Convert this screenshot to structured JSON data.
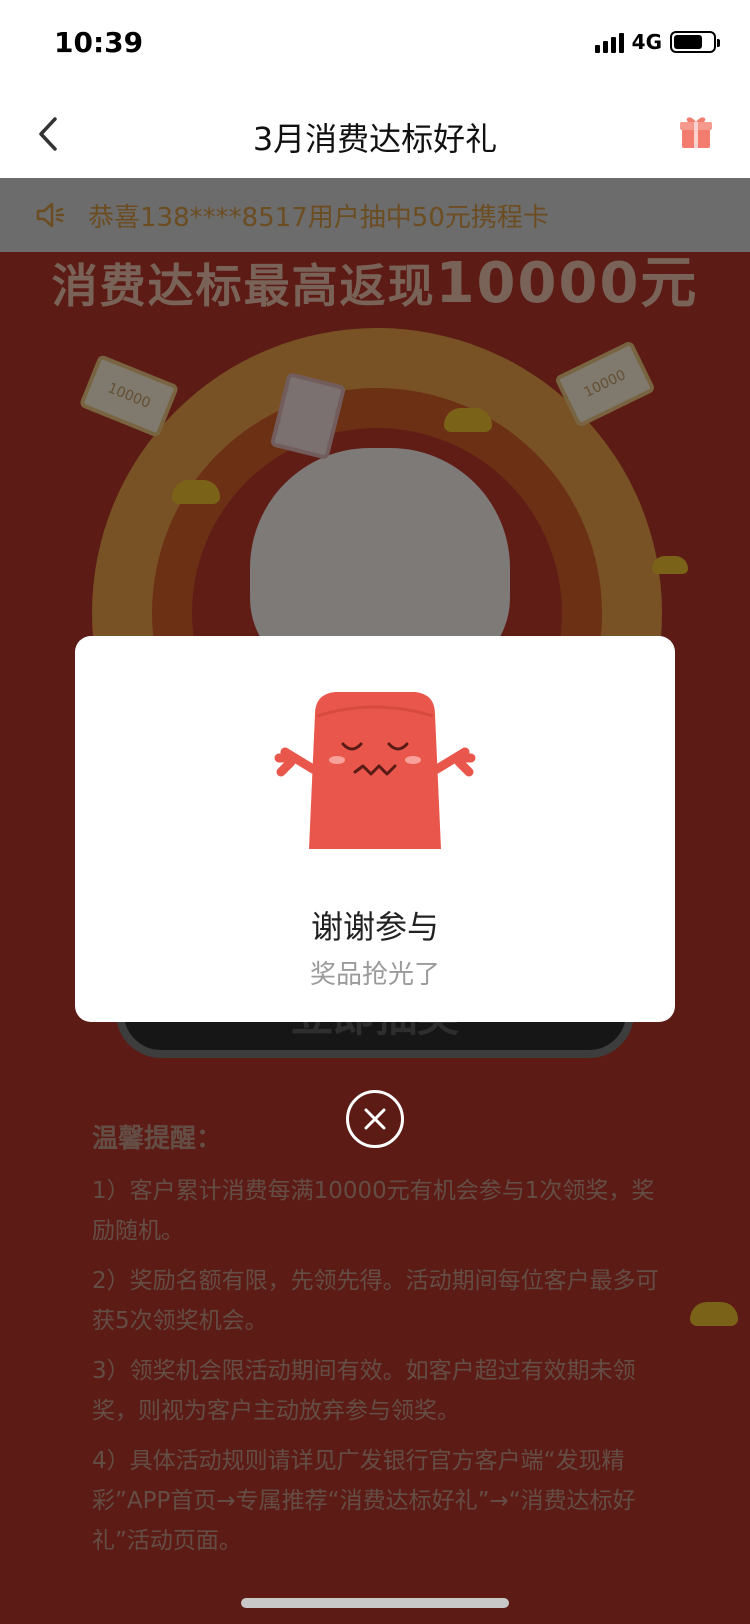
{
  "status_bar": {
    "time": "10:39",
    "network": "4G"
  },
  "nav": {
    "title": "3月消费达标好礼"
  },
  "notice": {
    "text": "恭喜138****8517用户抽中50元携程卡"
  },
  "headline": {
    "prefix": "消费达标最高返现",
    "amount": "10000元"
  },
  "draw_button": {
    "label": "立即抽奖"
  },
  "tips": {
    "title": "温馨提醒：",
    "items": [
      "1）客户累计消费每满10000元有机会参与1次领奖，奖励随机。",
      "2）奖励名额有限，先领先得。活动期间每位客户最多可获5次领奖机会。",
      "3）领奖机会限活动期间有效。如客户超过有效期未领奖，则视为客户主动放弃参与领奖。",
      "4）具体活动规则请详见广发银行官方客户端“发现精彩”APP首页→专属推荐“消费达标好礼”→“消费达标好礼”活动页面。"
    ]
  },
  "ticket_text": "10000",
  "modal": {
    "title": "谢谢参与",
    "subtitle": "奖品抢光了"
  },
  "colors": {
    "mascot": "#e9574c",
    "background_red": "#b9372a",
    "notice_text": "#d89a44"
  },
  "icons": {
    "back": "chevron-left-icon",
    "gift": "gift-icon",
    "speaker": "speaker-icon",
    "close": "close-icon"
  }
}
